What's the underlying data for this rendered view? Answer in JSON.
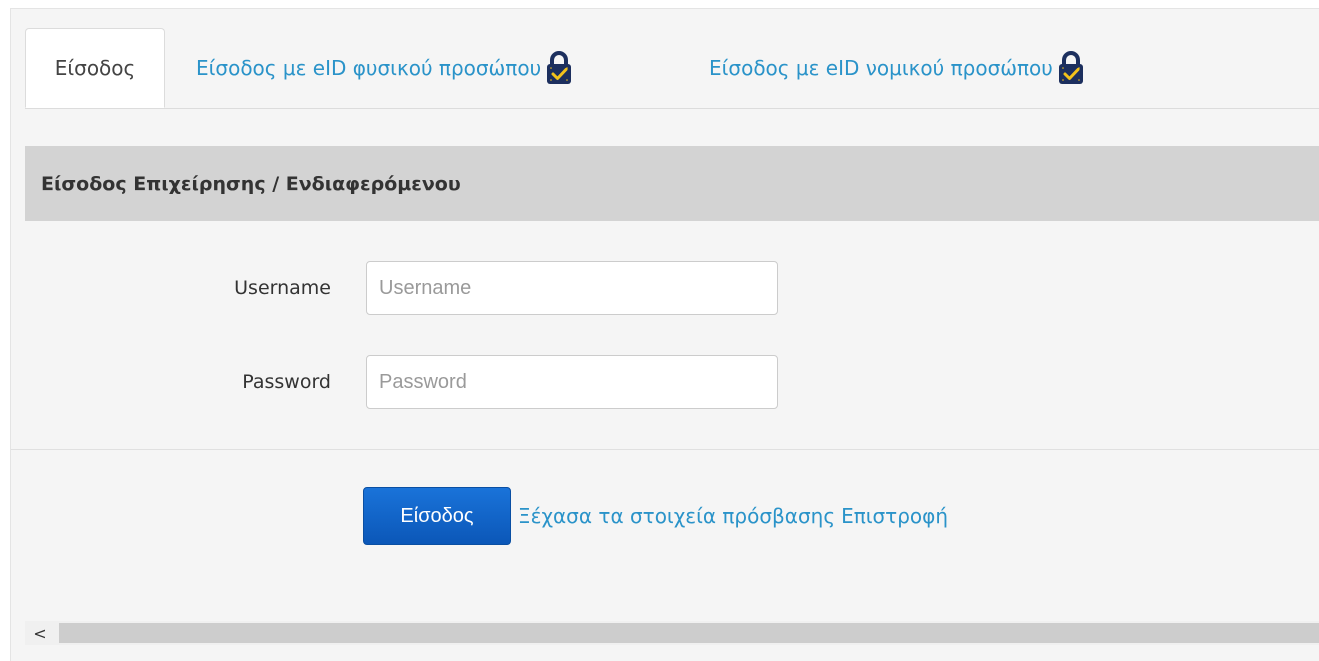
{
  "tabs": {
    "login": "Είσοδος",
    "eid_natural": "Είσοδος με eID φυσικού προσώπου",
    "eid_legal": "Είσοδος με eID νομικού προσώπου",
    "lock_icon": "padlock-check-icon"
  },
  "section": {
    "title": "Είσοδος Επιχείρησης / Ενδιαφερόμενου"
  },
  "form": {
    "username_label": "Username",
    "username_placeholder": "Username",
    "password_label": "Password",
    "password_placeholder": "Password"
  },
  "actions": {
    "submit_label": "Είσοδος",
    "forgot_link": "Ξέχασα τα στοιχεία πρόσβασης",
    "back_link": "Επιστροφή"
  },
  "scrollbar": {
    "left_arrow": "<"
  },
  "colors": {
    "link": "#2a93c9",
    "button": "#1465c7",
    "heading_bar": "#d3d3d3",
    "lock_body": "#1c2f5e",
    "lock_check": "#f2c21b"
  }
}
